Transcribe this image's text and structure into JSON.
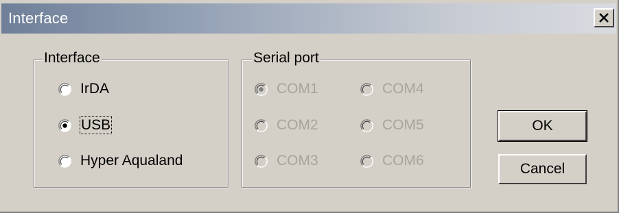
{
  "window": {
    "title": "Interface"
  },
  "interface_group": {
    "legend": "Interface",
    "options": [
      {
        "label": "IrDA",
        "selected": false
      },
      {
        "label": "USB",
        "selected": true
      },
      {
        "label": "Hyper Aqualand",
        "selected": false
      }
    ]
  },
  "serial_group": {
    "legend": "Serial port",
    "enabled": false,
    "options": [
      {
        "label": "COM1",
        "selected": true
      },
      {
        "label": "COM4",
        "selected": false
      },
      {
        "label": "COM2",
        "selected": false
      },
      {
        "label": "COM5",
        "selected": false
      },
      {
        "label": "COM3",
        "selected": false
      },
      {
        "label": "COM6",
        "selected": false
      }
    ]
  },
  "buttons": {
    "ok_label": "OK",
    "cancel_label": "Cancel"
  },
  "colors": {
    "face": "#d4d0c8",
    "title_start": "#6f7f99",
    "disabled_text": "#a8a49c"
  },
  "icons": {
    "close": "close-icon"
  }
}
